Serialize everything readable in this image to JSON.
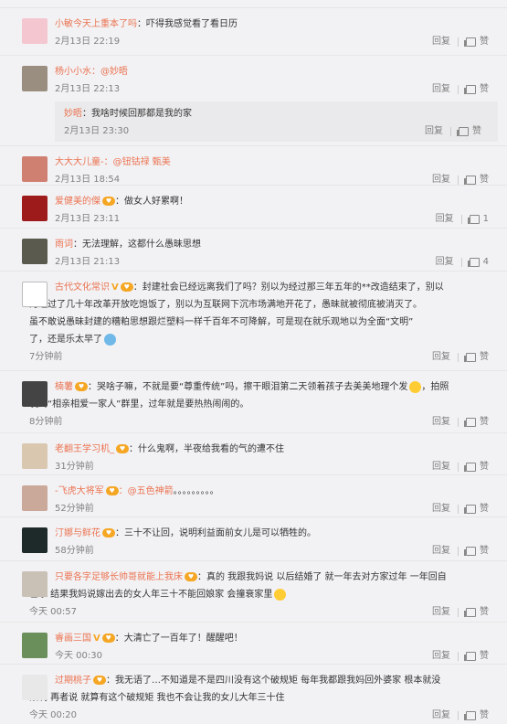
{
  "actions": {
    "reply": "回复",
    "like": "赞"
  },
  "comments": [
    {
      "user": "小敏今天上重本了吗",
      "text": "：吓得我感觉看了看日历",
      "time": "2月13日 22:19",
      "likes": ""
    },
    {
      "user": "杨小小水",
      "mention": "：@妙晤",
      "text": "",
      "time": "2月13日 22:13",
      "likes": "",
      "reply": {
        "user": "妙晤",
        "text": "：我啥时候回那都是我的家",
        "time": "2月13日 23:30"
      }
    },
    {
      "user": "大大大儿童-",
      "mention": "：@钮钴禄 甄美",
      "text": "",
      "time": "2月13日 18:54",
      "likes": ""
    },
    {
      "user": "爱健美的傑",
      "text": "：做女人好累啊！",
      "time": "2月13日 23:11",
      "likes": "1"
    },
    {
      "user": "雨词",
      "text": "：无法理解，这都什么愚昧思想",
      "time": "2月13日 21:13",
      "likes": "4"
    },
    {
      "user": "古代文化常识",
      "text1": "：封建社会已经远离我们了吗？别以为经过那三年五年的**改造结束了，别以",
      "text2": "为经过了几十年改革开放吃饱饭了，别以为互联网下沉市场满地开花了，愚昧就被彻底被消灭了。",
      "text3": "虽不敢说愚昧封建的糟粕思想跟烂塑料一样千百年不可降解，可是现在就乐观地以为全面“文明”",
      "text4": "了，还是乐太早了",
      "time": "7分钟前",
      "likes": ""
    },
    {
      "user": "楠薯",
      "text1": "：哭啥子嘛，不就是要“尊重传统”吗，擦干眼泪第二天领着孩子去美美地理个发",
      "text1b": "，拍照",
      "text2": "发到“相亲相爱一家人”群里，过年就是要热热闹闹的。",
      "time": "8分钟前",
      "likes": ""
    },
    {
      "user": "老翻王学习机_",
      "text": "：什么鬼啊，半夜给我看的气的遭不住",
      "time": "31分钟前",
      "likes": ""
    },
    {
      "user": "-飞虎大将军",
      "mention": "：@五色神箭",
      "text": "。。。。。。。。。",
      "time": "52分钟前",
      "likes": ""
    },
    {
      "user": "汀娜与鲜花",
      "text": "：三十不让回，说明利益面前女儿是可以牺牲的。",
      "time": "58分钟前",
      "likes": ""
    },
    {
      "user": "只要各字足够长帅哥就能上我床",
      "text1": "：真的 我跟我妈说 以后结婚了 就一年去对方家过年 一年回自",
      "text2": "己家 结果我妈说嫁出去的女人年三十不能回娘家 会撞衰家里",
      "time": "今天 00:57",
      "likes": ""
    },
    {
      "user": "睿画三国",
      "text": "：大清亡了一百年了！醒醒吧！",
      "time": "今天 00:30",
      "likes": ""
    },
    {
      "user": "过期桃子",
      "text1": "：我无语了…不知道是不是四川没有这个破规矩 每年我都跟我妈回外婆家 根本就没",
      "text2": "限制 再者说 就算有这个破规矩 我也不会让我的女儿大年三十住",
      "time": "今天 00:20",
      "likes": ""
    }
  ]
}
